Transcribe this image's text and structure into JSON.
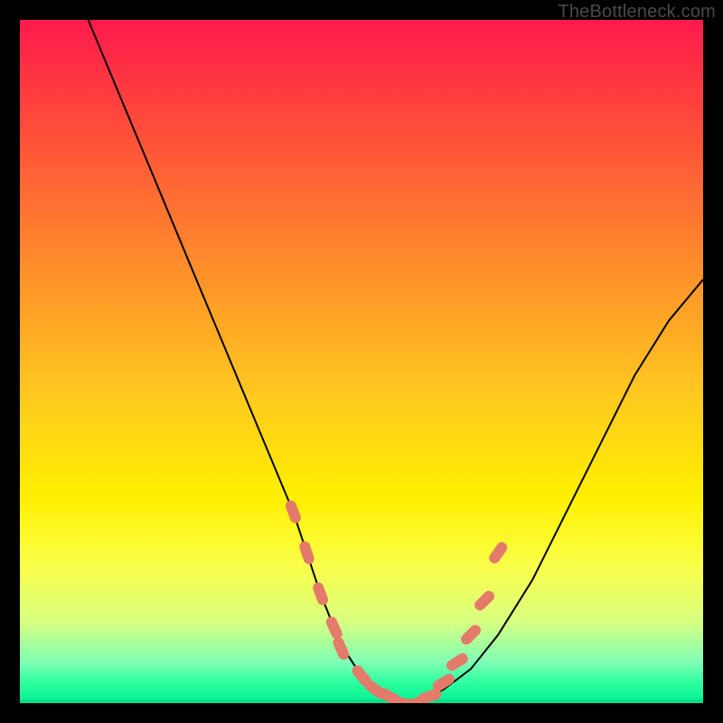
{
  "watermark": "TheBottleneck.com",
  "colors": {
    "frame": "#000000",
    "curve": "#000000",
    "marker": "#e47a6a",
    "gradient_top": "#ff1a4d",
    "gradient_bottom": "#00f090"
  },
  "chart_data": {
    "type": "line",
    "title": "",
    "xlabel": "",
    "ylabel": "",
    "xlim": [
      0,
      100
    ],
    "ylim": [
      0,
      100
    ],
    "grid": false,
    "legend": false,
    "annotations": [],
    "series": [
      {
        "name": "bottleneck-curve",
        "x": [
          10,
          15,
          20,
          25,
          30,
          35,
          40,
          42,
          44,
          46,
          48,
          50,
          52,
          54,
          56,
          58,
          62,
          66,
          70,
          75,
          80,
          85,
          90,
          95,
          100
        ],
        "y": [
          100,
          88,
          76,
          64,
          52,
          40,
          28,
          22,
          16,
          11,
          7,
          4,
          2,
          1,
          0,
          0,
          2,
          5,
          10,
          18,
          28,
          38,
          48,
          56,
          62
        ]
      }
    ],
    "markers": [
      {
        "name": "left-cluster",
        "x": [
          40,
          42,
          44,
          46,
          47
        ],
        "y": [
          28,
          22,
          16,
          11,
          8
        ]
      },
      {
        "name": "valley-cluster",
        "x": [
          50,
          52,
          54,
          56,
          58,
          60
        ],
        "y": [
          4,
          2,
          1,
          0,
          0,
          1
        ]
      },
      {
        "name": "right-cluster",
        "x": [
          62,
          64,
          66,
          68,
          70
        ],
        "y": [
          3,
          6,
          10,
          15,
          22
        ]
      }
    ]
  }
}
